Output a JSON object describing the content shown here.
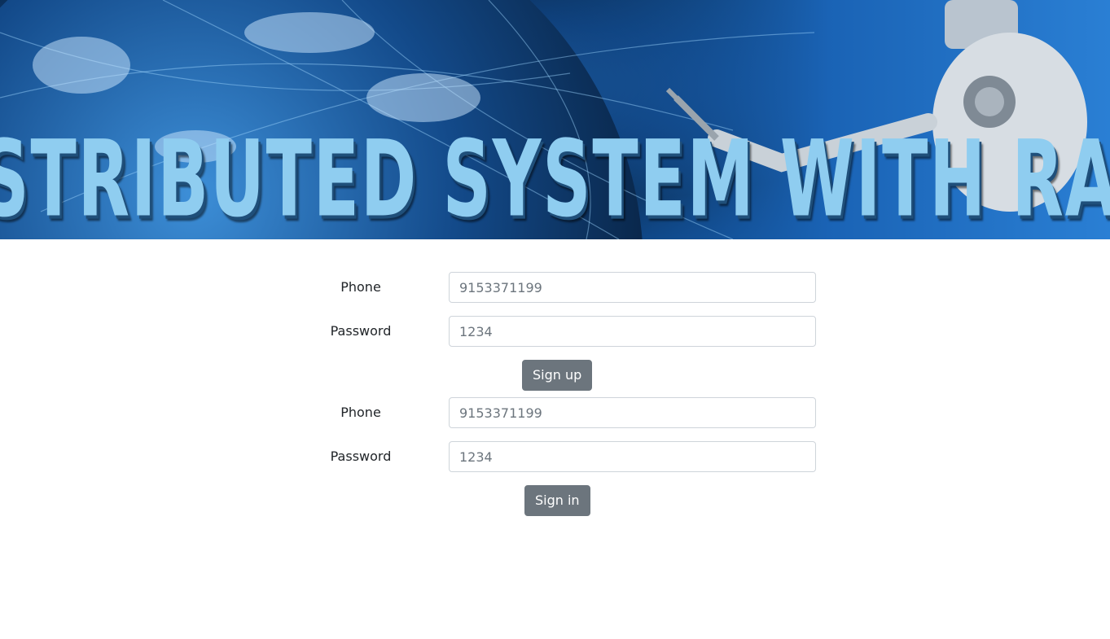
{
  "banner": {
    "title": "Distributed System With Raft"
  },
  "signup": {
    "phone_label": "Phone",
    "phone_placeholder": "9153371199",
    "password_label": "Password",
    "password_placeholder": "1234",
    "button_label": "Sign up"
  },
  "signin": {
    "phone_label": "Phone",
    "phone_placeholder": "9153371199",
    "password_label": "Password",
    "password_placeholder": "1234",
    "button_label": "Sign in"
  },
  "colors": {
    "button_bg": "#6c757d",
    "banner_text": "#8fcdf0"
  }
}
